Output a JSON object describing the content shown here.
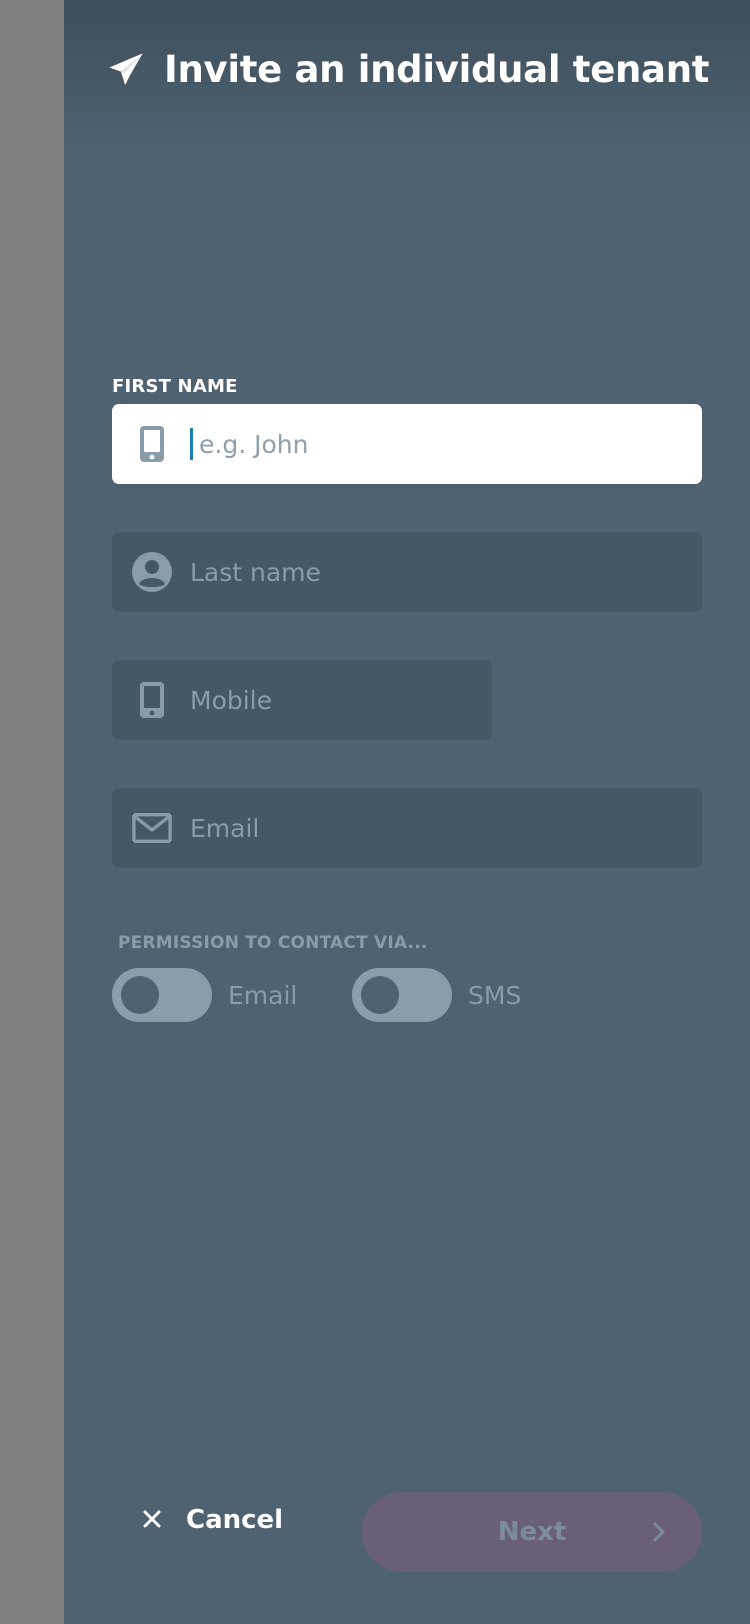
{
  "header": {
    "title": "Invite an individual tenant",
    "icon": "paper-plane-icon"
  },
  "form": {
    "first_name": {
      "label": "FIRST NAME",
      "placeholder": "e.g. John",
      "value": "",
      "icon": "mobile-phone-icon"
    },
    "last_name": {
      "placeholder": "Last name",
      "value": "",
      "icon": "person-icon"
    },
    "mobile": {
      "placeholder": "Mobile",
      "value": "",
      "icon": "mobile-phone-icon"
    },
    "email": {
      "placeholder": "Email",
      "value": "",
      "icon": "envelope-icon"
    }
  },
  "permission": {
    "label": "PERMISSION TO CONTACT VIA...",
    "options": [
      {
        "label": "Email",
        "enabled": false
      },
      {
        "label": "SMS",
        "enabled": false
      }
    ]
  },
  "footer": {
    "cancel_label": "Cancel",
    "cancel_icon": "close-icon",
    "next_label": "Next",
    "next_icon": "chevron-right-icon"
  },
  "colors": {
    "panel": "#4e6271",
    "field_inactive": "#455866",
    "toggle_off": "#8a9dab",
    "next_button": "#6a5f7b",
    "caret": "#1e7fb8"
  }
}
